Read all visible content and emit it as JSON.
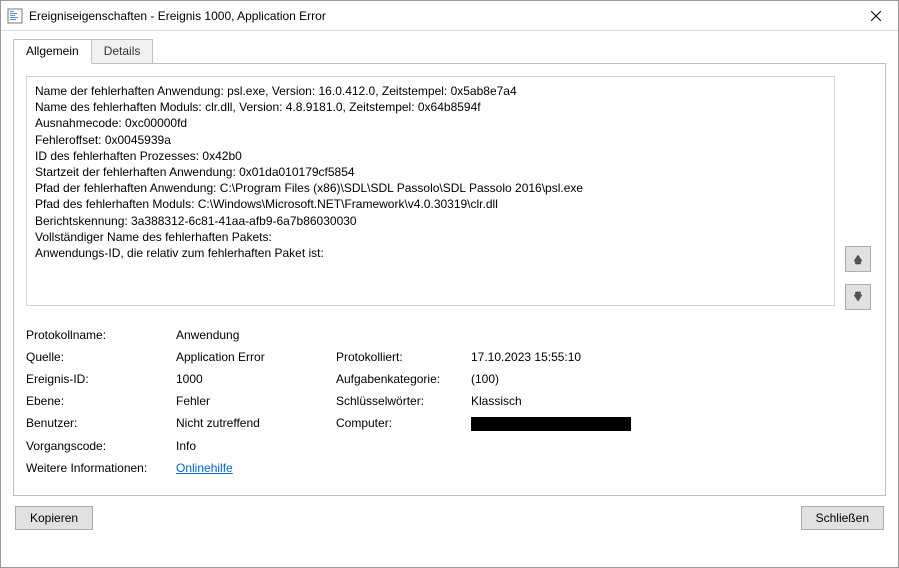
{
  "window": {
    "title": "Ereigniseigenschaften - Ereignis 1000, Application Error"
  },
  "tabs": {
    "general": "Allgemein",
    "details": "Details"
  },
  "event_text": "Name der fehlerhaften Anwendung: psl.exe, Version: 16.0.412.0, Zeitstempel: 0x5ab8e7a4\nName des fehlerhaften Moduls: clr.dll, Version: 4.8.9181.0, Zeitstempel: 0x64b8594f\nAusnahmecode: 0xc00000fd\nFehleroffset: 0x0045939a\nID des fehlerhaften Prozesses: 0x42b0\nStartzeit der fehlerhaften Anwendung: 0x01da010179cf5854\nPfad der fehlerhaften Anwendung: C:\\Program Files (x86)\\SDL\\SDL Passolo\\SDL Passolo 2016\\psl.exe\nPfad des fehlerhaften Moduls: C:\\Windows\\Microsoft.NET\\Framework\\v4.0.30319\\clr.dll\nBerichtskennung: 3a388312-6c81-41aa-afb9-6a7b86030030\nVollständiger Name des fehlerhaften Pakets:\nAnwendungs-ID, die relativ zum fehlerhaften Paket ist:",
  "labels": {
    "log_name": "Protokollname:",
    "source": "Quelle:",
    "event_id": "Ereignis-ID:",
    "level": "Ebene:",
    "user": "Benutzer:",
    "opcode": "Vorgangscode:",
    "logged": "Protokolliert:",
    "task_category": "Aufgabenkategorie:",
    "keywords": "Schlüsselwörter:",
    "computer": "Computer:",
    "more_info": "Weitere Informationen:"
  },
  "values": {
    "log_name": "Anwendung",
    "source": "Application Error",
    "event_id": "1000",
    "level": "Fehler",
    "user": "Nicht zutreffend",
    "opcode": "Info",
    "logged": "17.10.2023 15:55:10",
    "task_category": "(100)",
    "keywords": "Klassisch",
    "more_info_link": "Onlinehilfe"
  },
  "buttons": {
    "copy": "Kopieren",
    "close": "Schließen"
  }
}
